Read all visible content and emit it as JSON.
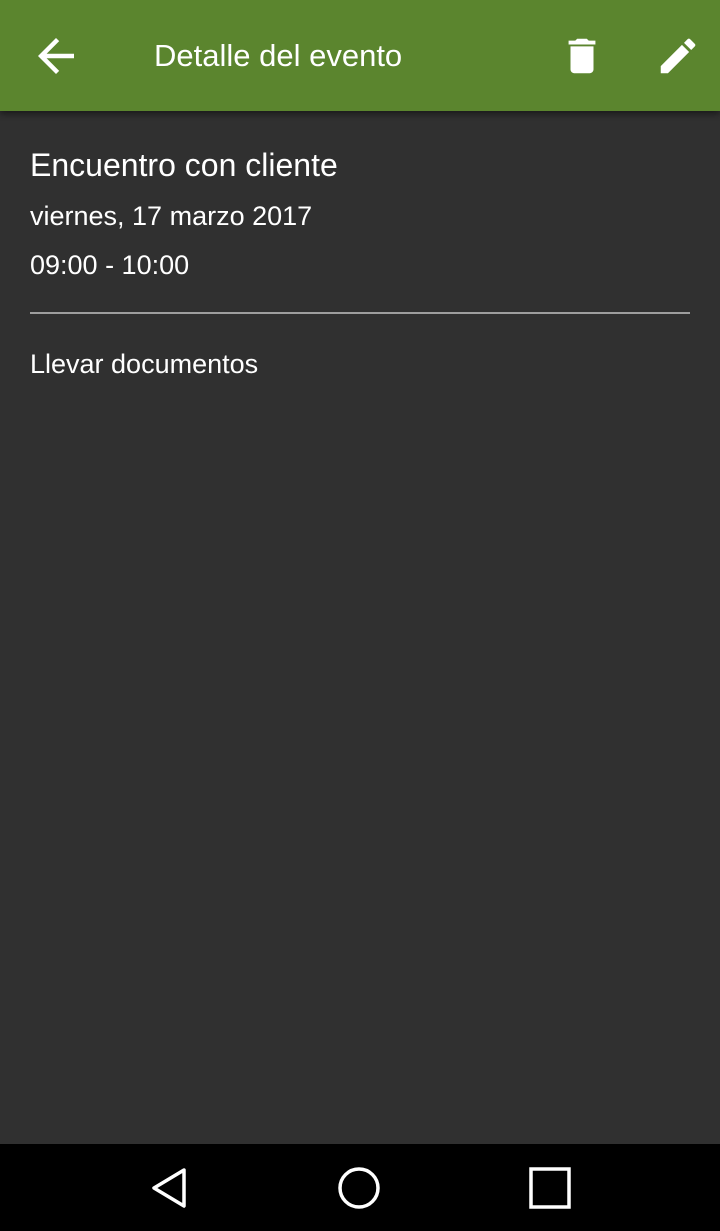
{
  "colors": {
    "app_bar": "#5b852e",
    "background": "#303030",
    "divider": "#9e9e9e",
    "text": "#ffffff",
    "nav_bar": "#000000"
  },
  "app_bar": {
    "title": "Detalle del evento",
    "back_icon": "arrow-left-icon",
    "delete_icon": "trash-icon",
    "edit_icon": "pencil-icon"
  },
  "event": {
    "title": "Encuentro con cliente",
    "date": "viernes, 17 marzo 2017",
    "time": "09:00 - 10:00",
    "notes": "Llevar documentos"
  },
  "nav_bar": {
    "back_icon": "triangle-back-icon",
    "home_icon": "circle-home-icon",
    "recents_icon": "square-recents-icon"
  }
}
